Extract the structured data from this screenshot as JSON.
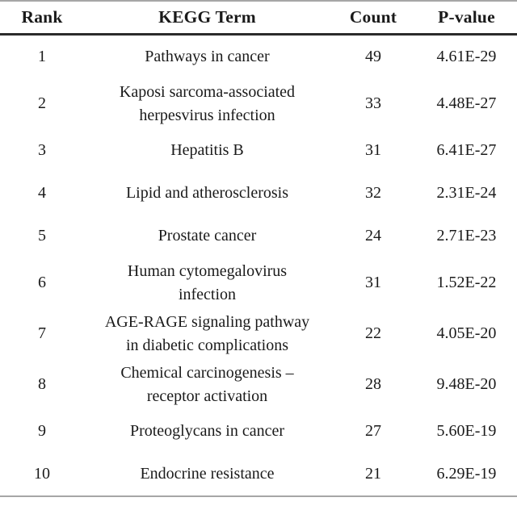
{
  "table": {
    "columns": [
      {
        "key": "rank",
        "label": "Rank",
        "align": "center"
      },
      {
        "key": "term",
        "label": "KEGG Term",
        "align": "center"
      },
      {
        "key": "count",
        "label": "Count",
        "align": "center"
      },
      {
        "key": "pvalue",
        "label": "P-value",
        "align": "center"
      }
    ],
    "rows": [
      {
        "rank": "1",
        "term_lines": [
          "Pathways in cancer"
        ],
        "count": "49",
        "pvalue": "4.61E-29"
      },
      {
        "rank": "2",
        "term_lines": [
          "Kaposi sarcoma-associated",
          "herpesvirus infection"
        ],
        "count": "33",
        "pvalue": "4.48E-27"
      },
      {
        "rank": "3",
        "term_lines": [
          "Hepatitis B"
        ],
        "count": "31",
        "pvalue": "6.41E-27"
      },
      {
        "rank": "4",
        "term_lines": [
          "Lipid and atherosclerosis"
        ],
        "count": "32",
        "pvalue": "2.31E-24"
      },
      {
        "rank": "5",
        "term_lines": [
          "Prostate cancer"
        ],
        "count": "24",
        "pvalue": "2.71E-23"
      },
      {
        "rank": "6",
        "term_lines": [
          "Human cytomegalovirus",
          "infection"
        ],
        "count": "31",
        "pvalue": "1.52E-22"
      },
      {
        "rank": "7",
        "term_lines": [
          "AGE-RAGE signaling pathway",
          "in diabetic complications"
        ],
        "count": "22",
        "pvalue": "4.05E-20"
      },
      {
        "rank": "8",
        "term_lines": [
          "Chemical carcinogenesis –",
          "receptor activation"
        ],
        "count": "28",
        "pvalue": "9.48E-20"
      },
      {
        "rank": "9",
        "term_lines": [
          "Proteoglycans in cancer"
        ],
        "count": "27",
        "pvalue": "5.60E-19"
      },
      {
        "rank": "10",
        "term_lines": [
          "Endocrine resistance"
        ],
        "count": "21",
        "pvalue": "6.29E-19"
      }
    ]
  },
  "style": {
    "text_color": "#1a1a1a",
    "rule_color_outer": "#a6a6a6",
    "rule_color_header": "#2b2b2b",
    "background": "#ffffff"
  }
}
